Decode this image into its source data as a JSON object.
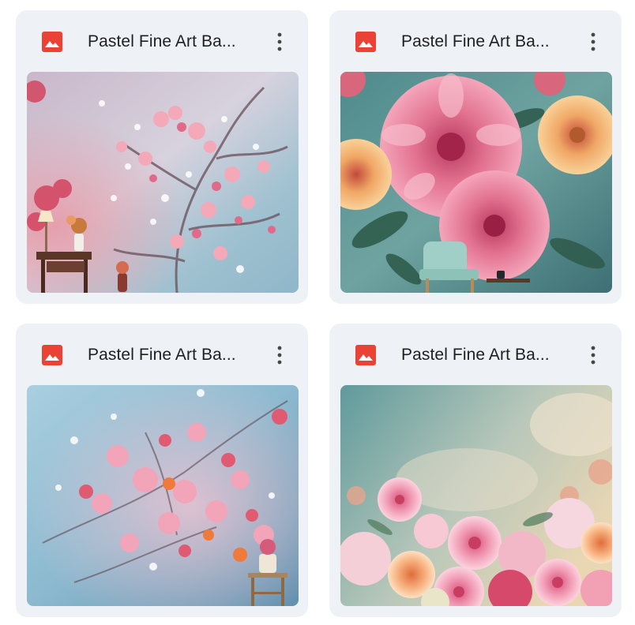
{
  "files": [
    {
      "title": "Pastel Fine Art Ba...",
      "file_type_icon": "image-file-icon",
      "menu_icon": "more-vert-icon",
      "thumbnail": "pastel cherry blossom branches with small side table and lamp"
    },
    {
      "title": "Pastel Fine Art Ba...",
      "file_type_icon": "image-file-icon",
      "menu_icon": "more-vert-icon",
      "thumbnail": "large pink and orange dahlias with mint armchair"
    },
    {
      "title": "Pastel Fine Art Ba...",
      "file_type_icon": "image-file-icon",
      "menu_icon": "more-vert-icon",
      "thumbnail": "pink blossoms on blue background with stool and vase"
    },
    {
      "title": "Pastel Fine Art Ba...",
      "file_type_icon": "image-file-icon",
      "menu_icon": "more-vert-icon",
      "thumbnail": "bouquet of pink dahlias on teal and cream background"
    }
  ],
  "colors": {
    "card_bg": "#eef1f6",
    "icon_red": "#ea4335",
    "title_text": "#1f1f1f",
    "menu_dots": "#444746"
  }
}
